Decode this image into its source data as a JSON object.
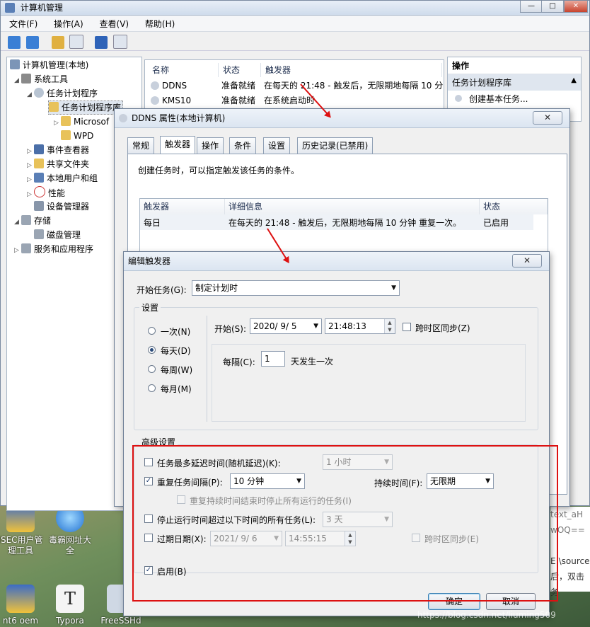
{
  "main_window": {
    "title": "计算机管理",
    "menu": [
      "文件(F)",
      "操作(A)",
      "查看(V)",
      "帮助(H)"
    ],
    "tree": [
      {
        "label": "计算机管理(本地)",
        "icon": "computer-icon"
      },
      {
        "label": "系统工具",
        "icon": "tools-icon"
      },
      {
        "label": "任务计划程序",
        "icon": "clock-icon"
      },
      {
        "label": "任务计划程序库",
        "icon": "folder-icon"
      },
      {
        "label": "Microsof",
        "icon": "folder-clock-icon"
      },
      {
        "label": "WPD",
        "icon": "folder-clock-icon"
      },
      {
        "label": "事件查看器",
        "icon": "event-viewer-icon"
      },
      {
        "label": "共享文件夹",
        "icon": "shared-folder-icon"
      },
      {
        "label": "本地用户和组",
        "icon": "users-icon"
      },
      {
        "label": "性能",
        "icon": "performance-icon"
      },
      {
        "label": "设备管理器",
        "icon": "device-manager-icon"
      },
      {
        "label": "存储",
        "icon": "storage-icon"
      },
      {
        "label": "磁盘管理",
        "icon": "disk-icon"
      },
      {
        "label": "服务和应用程序",
        "icon": "services-icon"
      }
    ],
    "list_headers": [
      "名称",
      "状态",
      "触发器"
    ],
    "list_rows": [
      {
        "name": "DDNS",
        "status": "准备就绪",
        "trigger": "在每天的 21:48 - 触发后，无限期地每隔 10 分"
      },
      {
        "name": "KMS10",
        "status": "准备就绪",
        "trigger": "在系统启动时"
      }
    ],
    "actions_header": "操作",
    "actions_section": "任务计划程序库",
    "actions_item": "创建基本任务..."
  },
  "properties_dialog": {
    "title": "DDNS 属性(本地计算机)",
    "close": "✕",
    "tabs": [
      "常规",
      "触发器",
      "操作",
      "条件",
      "设置",
      "历史记录(已禁用)"
    ],
    "description": "创建任务时，可以指定触发该任务的条件。",
    "grid_headers": [
      "触发器",
      "详细信息",
      "状态"
    ],
    "grid_rows": [
      {
        "trigger": "每日",
        "detail": "在每天的 21:48 - 触发后，无限期地每隔 10 分钟 重复一次。",
        "status": "已启用"
      }
    ]
  },
  "edit_trigger": {
    "title": "编辑触发器",
    "close": "✕",
    "begin_label": "开始任务(G):",
    "begin_value": "制定计划时",
    "settings_label": "设置",
    "radios": [
      {
        "label": "一次(N)",
        "checked": false
      },
      {
        "label": "每天(D)",
        "checked": true
      },
      {
        "label": "每周(W)",
        "checked": false
      },
      {
        "label": "每月(M)",
        "checked": false
      }
    ],
    "start_label": "开始(S):",
    "start_date": "2020/  9/  5",
    "start_time": "21:48:13",
    "sync_tz_label": "跨时区同步(Z)",
    "every_label": "每隔(C):",
    "every_value": "1",
    "every_suffix": "天发生一次",
    "advanced_label": "高级设置",
    "delay_label": "任务最多延迟时间(随机延迟)(K):",
    "delay_value": "1 小时",
    "repeat_label": "重复任务间隔(P):",
    "repeat_value": "10 分钟",
    "duration_label": "持续时间(F):",
    "duration_value": "无限期",
    "stop_running_label": "重复持续时间结束时停止所有运行的任务(I)",
    "stop_longer_label": "停止运行时间超过以下时间的所有任务(L):",
    "stop_longer_value": "3 天",
    "expire_label": "过期日期(X):",
    "expire_date": "2021/  9/  6",
    "expire_time": "14:55:15",
    "expire_sync_label": "跨时区同步(E)",
    "enabled_label": "启用(B)",
    "ok": "确定",
    "cancel": "取消"
  },
  "desktop_icons": [
    {
      "label": "ISEC用户管理工具",
      "icon": "shield-icon"
    },
    {
      "label": "毒霸网址大全",
      "icon": "ie-icon"
    },
    {
      "label": "nt6 oem",
      "icon": "shield-icon"
    },
    {
      "label": "Typora",
      "icon": "typora-icon"
    },
    {
      "label": "FreeSSHd",
      "icon": "app-icon"
    }
  ],
  "background_text": [
    "text_aH",
    "wOQ==",
    "E:\\source",
    "后，双击",
    "务"
  ],
  "watermark": "https://blog.csdn.net/liuming509",
  "colors": {
    "accent_red": "#dd1111",
    "selection": "#cce4f7"
  }
}
